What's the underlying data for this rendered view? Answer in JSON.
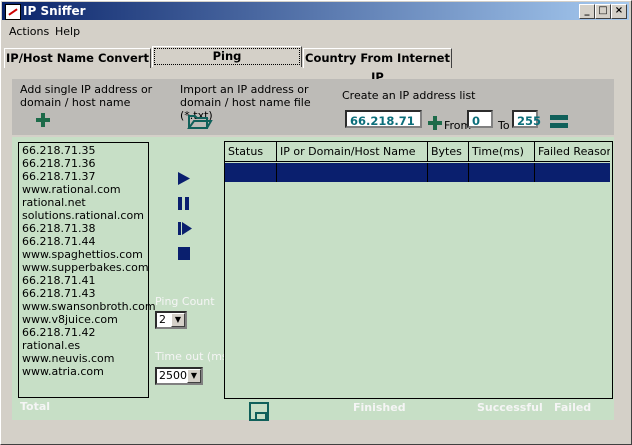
{
  "window": {
    "title": "IP Sniffer",
    "min_glyph": "_",
    "max_glyph": "□",
    "close_glyph": "×"
  },
  "menu": {
    "actions": "Actions",
    "help": "Help"
  },
  "tabs": [
    {
      "label": "IP/Host Name Convert"
    },
    {
      "label": "Ping"
    },
    {
      "label": "Country From Internet IP"
    }
  ],
  "toolbar": {
    "add_single_label": "Add single IP address or domain / host name",
    "import_label": "Import an IP address or domain / host name file (*.txt)",
    "create_list_label": "Create an IP address list",
    "base_ip": "66.218.71",
    "from_label": "From",
    "from_value": "0",
    "to_label": "To",
    "to_value": "255"
  },
  "host_list": [
    "66.218.71.35",
    "66.218.71.36",
    "66.218.71.37",
    "www.rational.com",
    "rational.net",
    "solutions.rational.com",
    "66.218.71.38",
    "66.218.71.44",
    "www.spaghettios.com",
    "www.supperbakes.com",
    "66.218.71.41",
    "66.218.71.43",
    "www.swansonbroth.com",
    "www.v8juice.com",
    "66.218.71.42",
    "rational.es",
    "www.neuvis.com",
    "www.atria.com"
  ],
  "ping_settings": {
    "ping_count_label": "Ping Count",
    "ping_count_value": "2",
    "timeout_label": "Time out (ms)",
    "timeout_value": "2500"
  },
  "results_table": {
    "columns": [
      "Status",
      "IP or Domain/Host Name",
      "Bytes",
      "Time(ms)",
      "Failed Reason"
    ]
  },
  "footer": {
    "total_label": "Total",
    "finished_label": "Finished",
    "successful_label": "Successful",
    "failed_label": "Failed"
  },
  "colors": {
    "accent": "#0a1f6e",
    "panel_green": "#c7dfc6",
    "icon_green": "#1d6b4a",
    "value_teal": "#0b6e7a"
  },
  "icons": [
    "plus-icon",
    "open-folder-icon",
    "plus-icon",
    "list-icon",
    "play-icon",
    "pause-icon",
    "step-icon",
    "stop-icon",
    "save-icon"
  ]
}
